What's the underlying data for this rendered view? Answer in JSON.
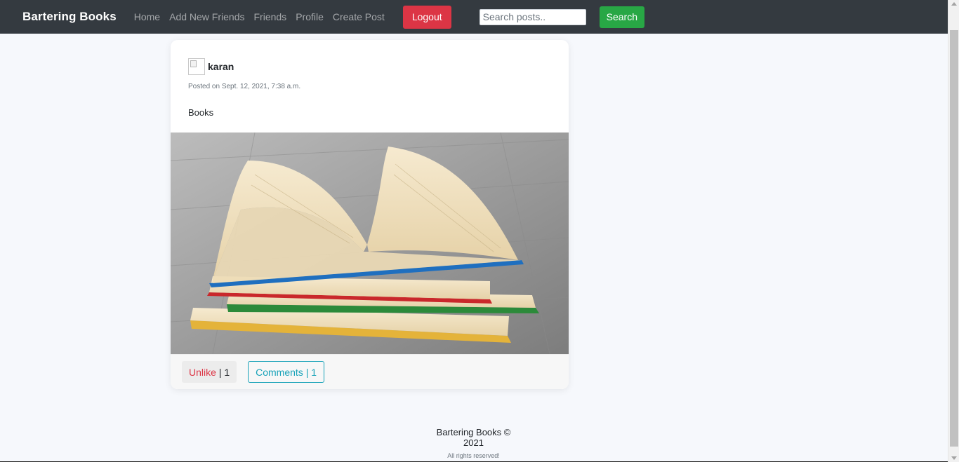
{
  "navbar": {
    "brand": "Bartering Books",
    "links": [
      "Home",
      "Add New Friends",
      "Friends",
      "Profile",
      "Create Post"
    ],
    "logout_label": "Logout",
    "search_placeholder": "Search posts..",
    "search_label": "Search"
  },
  "post": {
    "author": "karan",
    "posted_on": "Posted on Sept. 12, 2021, 7:38 a.m.",
    "text": "Books",
    "like_label": "Unlike",
    "like_separator": " | ",
    "like_count": "1",
    "comments_label": "Comments | 1"
  },
  "footer": {
    "title": "Bartering Books © 2021",
    "subtitle": "All rights reserved!"
  },
  "colors": {
    "navbar_bg": "#343a40",
    "logout": "#dc3545",
    "search": "#28a745",
    "comments": "#17a2b8",
    "page_bg": "#f6f8fc"
  }
}
